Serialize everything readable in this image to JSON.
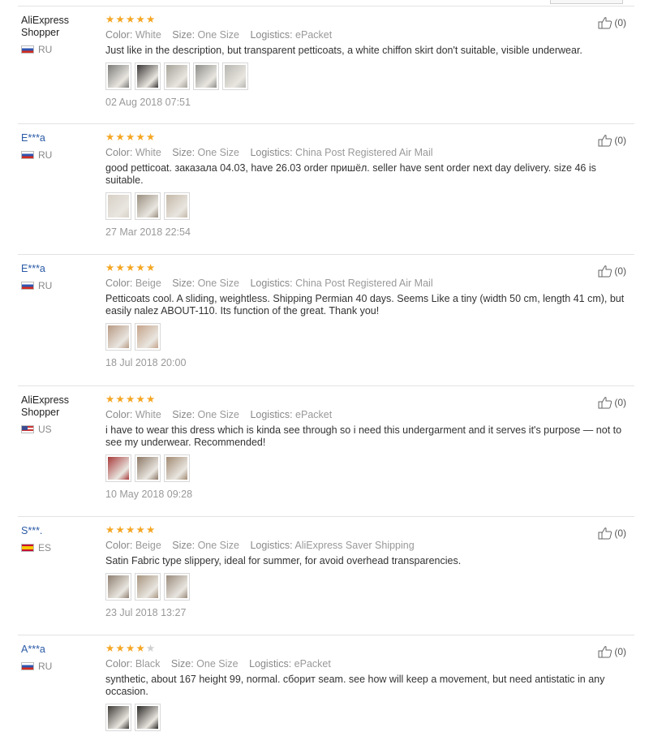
{
  "labels": {
    "color": "Color:",
    "size": "Size:",
    "logistics": "Logistics:"
  },
  "reviews": [
    {
      "user": "AliExpress Shopper",
      "country": "RU",
      "flag": "ru",
      "masked": false,
      "stars": 5,
      "color": "White",
      "size": "One Size",
      "logistics": "ePacket",
      "text": "Just like in the description, but transparent petticoats, a white chiffon skirt don't suitable, visible underwear.",
      "photos": [
        "#7c7b78",
        "#3a3636",
        "#a6a39a",
        "#8e8e8a",
        "#b8b6b0"
      ],
      "date": "02 Aug 2018 07:51",
      "helpful": "(0)"
    },
    {
      "user": "E***a",
      "country": "RU",
      "flag": "ru",
      "masked": true,
      "stars": 5,
      "color": "White",
      "size": "One Size",
      "logistics": "China Post Registered Air Mail",
      "text": "good petticoat. заказала 04.03, have 26.03 order пришёл. seller have sent order next day delivery. size 46 is suitable.",
      "photos": [
        "#d7d0c6",
        "#9a8f80",
        "#c4b8a8"
      ],
      "date": "27 Mar 2018 22:54",
      "helpful": "(0)"
    },
    {
      "user": "E***a",
      "country": "RU",
      "flag": "ru",
      "masked": true,
      "stars": 5,
      "color": "Beige",
      "size": "One Size",
      "logistics": "China Post Registered Air Mail",
      "text": "Petticoats cool. A sliding, weightless. Shipping Permian 40 days. Seems Like a tiny (width 50 cm, length 41 cm), but easily nalez ABOUT-110. Its function of the great. Thank you!",
      "photos": [
        "#b89a84",
        "#c5a48a"
      ],
      "date": "18 Jul 2018 20:00",
      "helpful": "(0)"
    },
    {
      "user": "AliExpress Shopper",
      "country": "US",
      "flag": "us",
      "masked": false,
      "stars": 5,
      "color": "White",
      "size": "One Size",
      "logistics": "ePacket",
      "text": "i have to wear this dress which is kinda see through so i need this undergarment and it serves it's purpose — not to see my underwear. Recommended!",
      "photos": [
        "#a83a3a",
        "#8c7866",
        "#a28a72"
      ],
      "date": "10 May 2018 09:28",
      "helpful": "(0)"
    },
    {
      "user": "S***.",
      "country": "ES",
      "flag": "es",
      "masked": true,
      "stars": 5,
      "color": "Beige",
      "size": "One Size",
      "logistics": "AliExpress Saver Shipping",
      "text": "Satin Fabric type slippery, ideal for summer, for avoid overhead transparencies.",
      "photos": [
        "#8f7f70",
        "#a89580",
        "#9a8b7c"
      ],
      "date": "23 Jul 2018 13:27",
      "helpful": "(0)"
    },
    {
      "user": "A***a",
      "country": "RU",
      "flag": "ru",
      "masked": true,
      "stars": 4,
      "color": "Black",
      "size": "One Size",
      "logistics": "ePacket",
      "text": "synthetic, about 167 height 99, normal. сборит seam. see how will keep a movement, but need antistatic in any occasion.",
      "photos": [
        "#3d3a36",
        "#2b2926"
      ],
      "date": "",
      "helpful": "(0)"
    }
  ]
}
